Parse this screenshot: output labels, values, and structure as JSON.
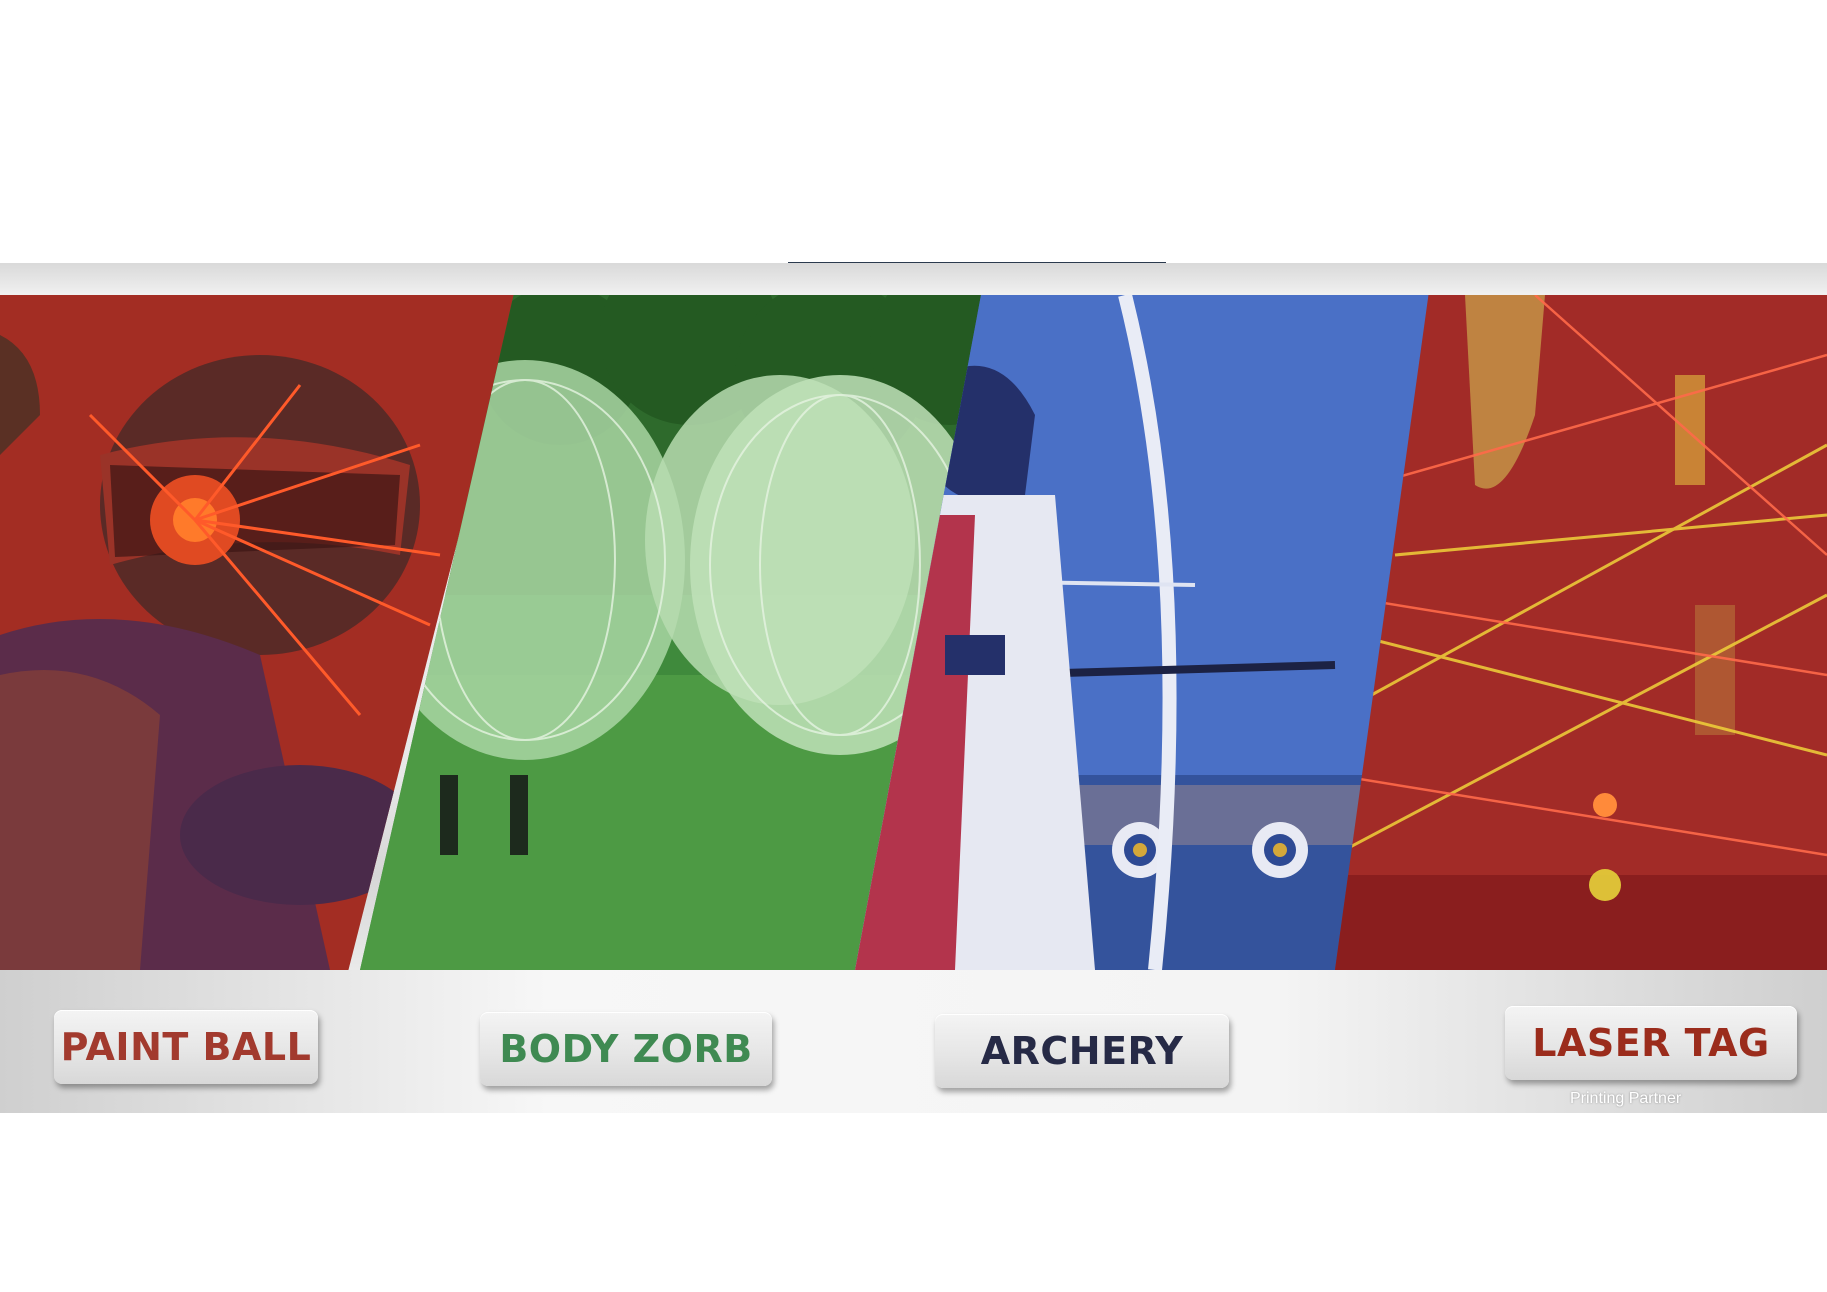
{
  "activities": [
    {
      "label": "PAINT BALL",
      "color": "#a23a2e",
      "icon": "paintball-photo"
    },
    {
      "label": "BODY ZORB",
      "color": "#3f8a52",
      "icon": "body-zorb-photo"
    },
    {
      "label": "ARCHERY",
      "color": "#262a46",
      "icon": "archery-photo"
    },
    {
      "label": "LASER TAG",
      "color": "#9b2c1c",
      "icon": "laser-tag-photo"
    }
  ],
  "footer": {
    "note": "Printing Partner"
  },
  "theme": {
    "divider_color": "#2b3a4e"
  }
}
